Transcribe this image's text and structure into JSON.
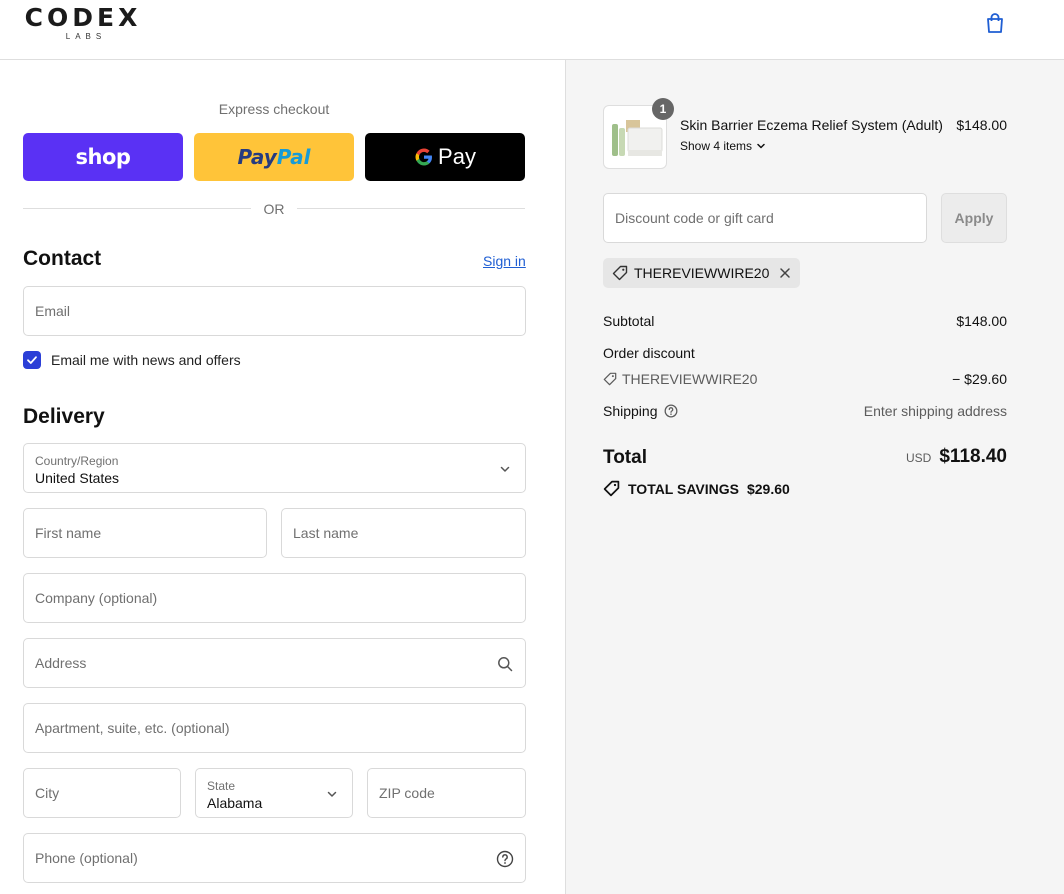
{
  "header": {
    "logo_main": "CODEX",
    "logo_sub": "LABS"
  },
  "express": {
    "title": "Express checkout",
    "shop_label": "shop",
    "paypal_label_a": "Pay",
    "paypal_label_b": "Pal",
    "gpay_label": "Pay",
    "or_label": "OR"
  },
  "contact": {
    "title": "Contact",
    "sign_in": "Sign in",
    "email_placeholder": "Email",
    "newsletter_label": "Email me with news and offers",
    "newsletter_checked": true
  },
  "delivery": {
    "title": "Delivery",
    "country_label": "Country/Region",
    "country_value": "United States",
    "first_name_placeholder": "First name",
    "last_name_placeholder": "Last name",
    "company_placeholder": "Company (optional)",
    "address_placeholder": "Address",
    "apartment_placeholder": "Apartment, suite, etc. (optional)",
    "city_placeholder": "City",
    "state_label": "State",
    "state_value": "Alabama",
    "zip_placeholder": "ZIP code",
    "phone_placeholder": "Phone (optional)"
  },
  "summary": {
    "product": {
      "quantity": "1",
      "name": "Skin Barrier Eczema Relief System (Adult)",
      "price": "$148.00",
      "show_items": "Show 4 items"
    },
    "discount_placeholder": "Discount code or gift card",
    "apply_label": "Apply",
    "applied_code": "THEREVIEWWIRE20",
    "subtotal_label": "Subtotal",
    "subtotal_value": "$148.00",
    "order_discount_label": "Order discount",
    "order_discount_code": "THEREVIEWWIRE20",
    "order_discount_value": "− $29.60",
    "shipping_label": "Shipping",
    "shipping_value": "Enter shipping address",
    "total_label": "Total",
    "total_currency": "USD",
    "total_value": "$118.40",
    "savings_label": "TOTAL SAVINGS",
    "savings_value": "$29.60"
  },
  "colors": {
    "shop": "#5a31f4",
    "paypal": "#ffc439",
    "link": "#1f5ed3",
    "checkbox": "#2b3fd7"
  }
}
